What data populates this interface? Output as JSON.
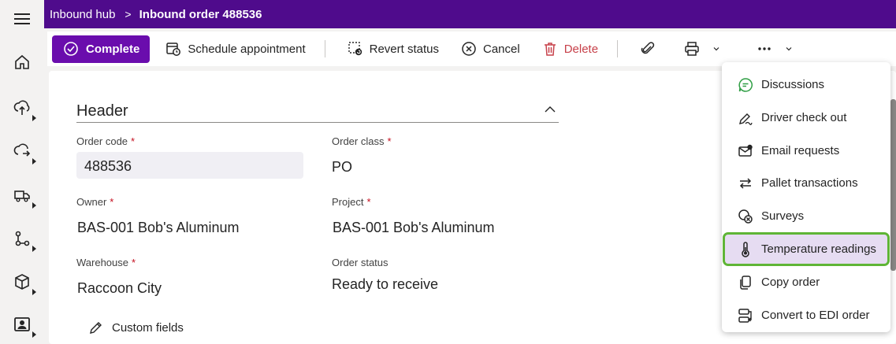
{
  "breadcrumb": {
    "parent": "Inbound hub",
    "separator": ">",
    "current": "Inbound order 488536"
  },
  "commands": {
    "complete": "Complete",
    "schedule": "Schedule appointment",
    "revert": "Revert status",
    "cancel": "Cancel",
    "delete": "Delete"
  },
  "colors": {
    "brand": "#4f0b8c",
    "primary": "#6a0dad",
    "danger": "#c7414a",
    "highlight": "#5fb536"
  },
  "rail_icons": [
    "home-icon",
    "inbound-icon",
    "outbound-icon",
    "truck-icon",
    "workflow-icon",
    "box-icon",
    "contact-card-icon"
  ],
  "section": {
    "title": "Header"
  },
  "fields": {
    "order_code": {
      "label": "Order code",
      "value": "488536",
      "required": "*"
    },
    "order_class": {
      "label": "Order class",
      "value": "PO",
      "required": "*"
    },
    "owner": {
      "label": "Owner",
      "value": "BAS-001 Bob's Aluminum",
      "required": "*"
    },
    "project": {
      "label": "Project",
      "value": "BAS-001 Bob's Aluminum",
      "required": "*"
    },
    "warehouse": {
      "label": "Warehouse",
      "value": "Raccoon City",
      "required": "*"
    },
    "order_status": {
      "label": "Order status",
      "value": "Ready to receive"
    }
  },
  "custom_fields": "Custom fields",
  "menu": {
    "items": [
      {
        "label": "Discussions",
        "icon": "chat-icon"
      },
      {
        "label": "Driver check out",
        "icon": "signature-icon"
      },
      {
        "label": "Email requests",
        "icon": "mail-icon"
      },
      {
        "label": "Pallet transactions",
        "icon": "swap-icon"
      },
      {
        "label": "Surveys",
        "icon": "survey-icon"
      },
      {
        "label": "Temperature readings",
        "icon": "thermometer-icon"
      },
      {
        "label": "Copy order",
        "icon": "copy-icon"
      },
      {
        "label": "Convert to EDI order",
        "icon": "convert-icon"
      }
    ]
  }
}
